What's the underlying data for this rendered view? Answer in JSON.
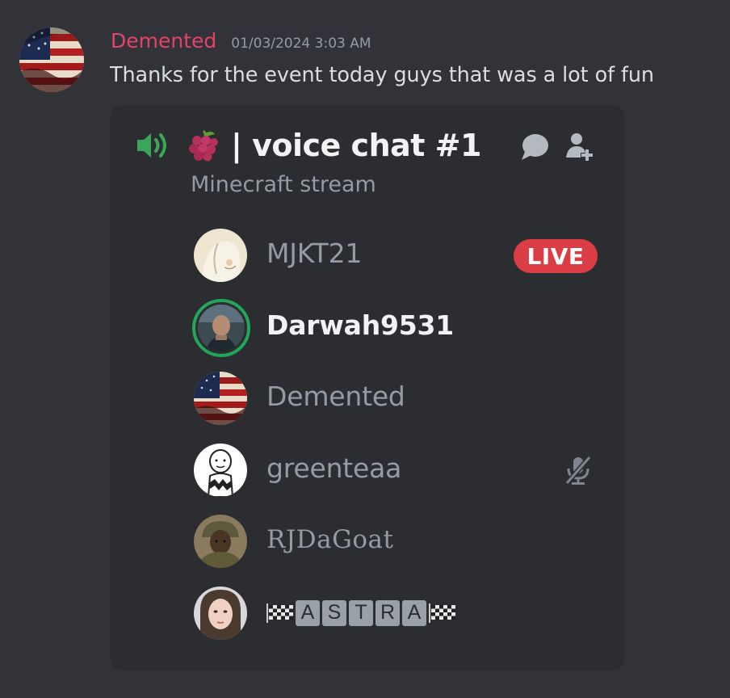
{
  "message": {
    "author": "Demented",
    "timestamp": "01/03/2024 3:03 AM",
    "text": "Thanks for the event today guys that was a lot of fun"
  },
  "voice_card": {
    "channel_name": "| voice chat #1",
    "topic": "Minecraft stream",
    "icons": {
      "speaker": "speaker-icon",
      "grapes": "grapes-emoji-icon",
      "chat": "chat-bubble-icon",
      "invite": "add-user-icon"
    },
    "members": [
      {
        "name": "MJKT21",
        "badge": "LIVE"
      },
      {
        "name": "Darwah9531"
      },
      {
        "name": "Demented"
      },
      {
        "name": "greenteaa",
        "status_icon": "mic-muted-icon"
      },
      {
        "name": "RJDaGoat"
      },
      {
        "name_letters": [
          "A",
          "S",
          "T",
          "R",
          "A"
        ],
        "decor_icon": "checkered-flag-icon"
      }
    ]
  },
  "colors": {
    "background": "#313338",
    "card": "#2b2d31",
    "author_name": "#e3426b",
    "speaking_ring": "#23a55a",
    "live_badge": "#da3e44"
  }
}
